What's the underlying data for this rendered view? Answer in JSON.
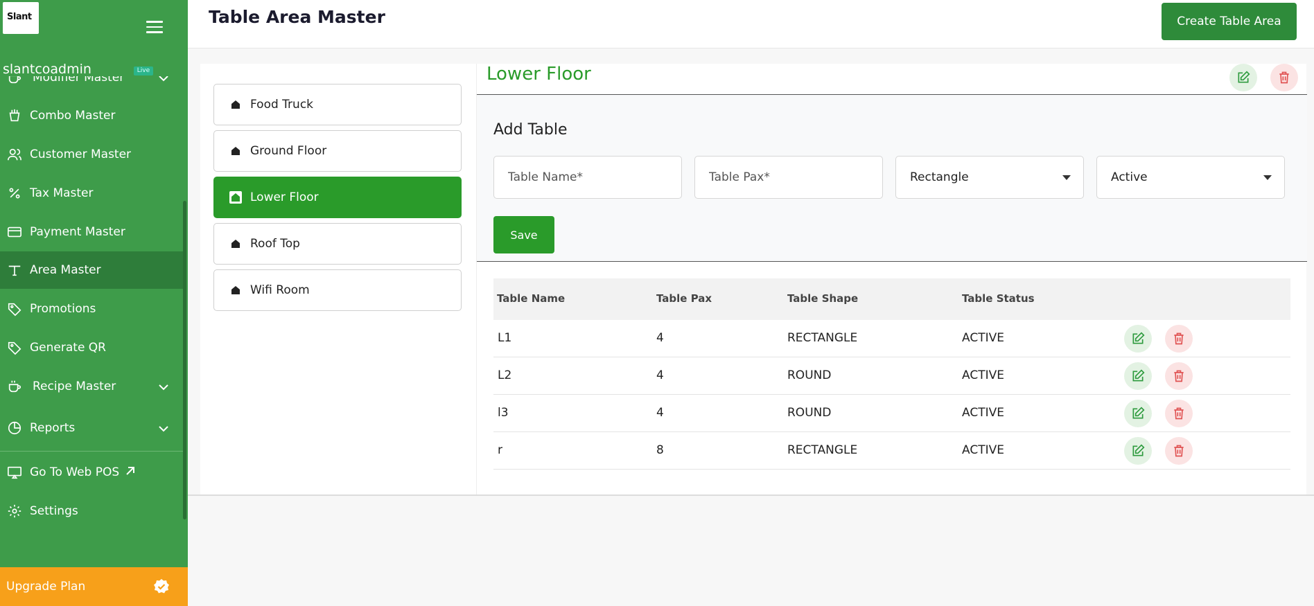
{
  "sidebar": {
    "logo_text": "Slant",
    "username": "slantcoadmin",
    "live_badge": "Live",
    "items": [
      {
        "label": "Modifier Master",
        "icon": "cup-icon",
        "expandable": true
      },
      {
        "label": "Combo Master",
        "icon": "combo-icon"
      },
      {
        "label": "Customer Master",
        "icon": "users-icon"
      },
      {
        "label": "Tax Master",
        "icon": "percent-icon"
      },
      {
        "label": "Payment Master",
        "icon": "card-icon"
      },
      {
        "label": "Area Master",
        "icon": "table-icon",
        "active": true
      },
      {
        "label": "Promotions",
        "icon": "tag-icon"
      },
      {
        "label": "Generate QR",
        "icon": "tag-icon"
      },
      {
        "label": "Recipe Master",
        "icon": "cup-icon",
        "expandable": true
      },
      {
        "label": "Reports",
        "icon": "pie-chart-icon",
        "expandable": true
      },
      {
        "label": "Go To Web POS",
        "icon": "monitor-icon",
        "external": true
      },
      {
        "label": "Settings",
        "icon": "gear-icon"
      }
    ],
    "upgrade_label": "Upgrade Plan"
  },
  "header": {
    "title": "Table Area Master",
    "create_button": "Create Table Area"
  },
  "areas": [
    {
      "label": "Food Truck"
    },
    {
      "label": "Ground Floor"
    },
    {
      "label": "Lower Floor",
      "active": true
    },
    {
      "label": "Roof Top"
    },
    {
      "label": "Wifi Room"
    }
  ],
  "detail": {
    "title": "Lower Floor",
    "add_title": "Add Table",
    "name_placeholder": "Table Name*",
    "pax_placeholder": "Table Pax*",
    "shape_value": "Rectangle",
    "status_value": "Active",
    "save_label": "Save"
  },
  "table": {
    "headers": [
      "Table Name",
      "Table Pax",
      "Table Shape",
      "Table Status"
    ],
    "rows": [
      {
        "name": "L1",
        "pax": "4",
        "shape": "RECTANGLE",
        "status": "ACTIVE"
      },
      {
        "name": "L2",
        "pax": "4",
        "shape": "ROUND",
        "status": "ACTIVE"
      },
      {
        "name": "l3",
        "pax": "4",
        "shape": "ROUND",
        "status": "ACTIVE"
      },
      {
        "name": "r",
        "pax": "8",
        "shape": "RECTANGLE",
        "status": "ACTIVE"
      }
    ]
  },
  "colors": {
    "sidebar_bg": "#3e9c4a",
    "sidebar_active": "#2e7d3a",
    "accent_green": "#2a9b2a",
    "upgrade_orange": "#f7a01a",
    "edit_green": "#2e9b3e",
    "delete_red": "#e05252"
  }
}
